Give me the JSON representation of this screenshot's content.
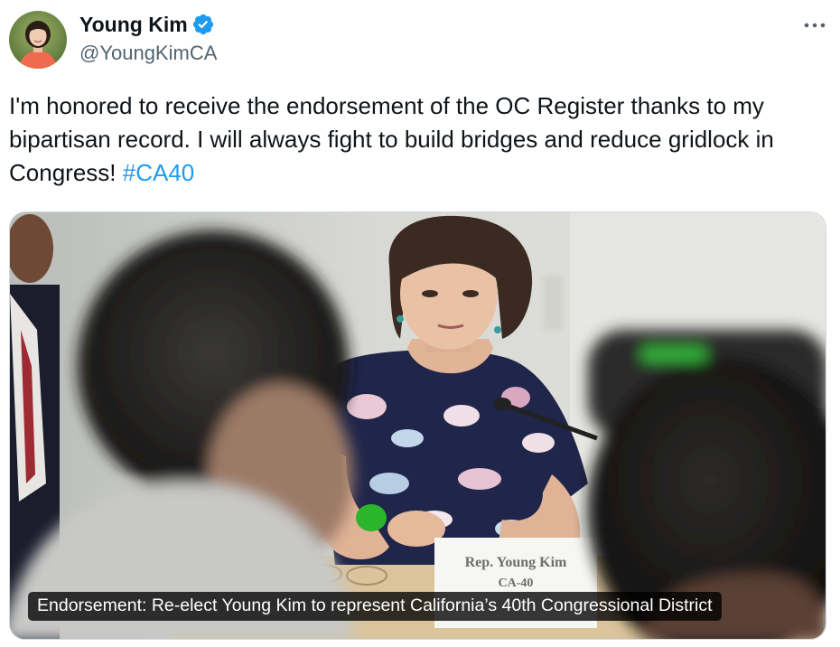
{
  "author": {
    "display_name": "Young Kim",
    "handle": "@YoungKimCA",
    "verified": true,
    "avatar_icon": "profile-photo"
  },
  "tweet": {
    "text": "I'm honored to receive the endorsement of the OC Register thanks to my bipartisan record. I will always fight to build bridges and reduce gridlock in Congress! ",
    "hashtag": "#CA40"
  },
  "media": {
    "caption": "Endorsement: Re-elect Young Kim to represent California’s 40th Congressional District",
    "nameplate_line1": "Rep. Young Kim",
    "nameplate_line2": "CA-40"
  },
  "colors": {
    "link": "#1d9bf0",
    "verified": "#1d9bf0",
    "text": "#0f1419",
    "secondary": "#536471"
  },
  "icons": {
    "verified": "verified-badge-icon",
    "more": "more-options-icon"
  }
}
